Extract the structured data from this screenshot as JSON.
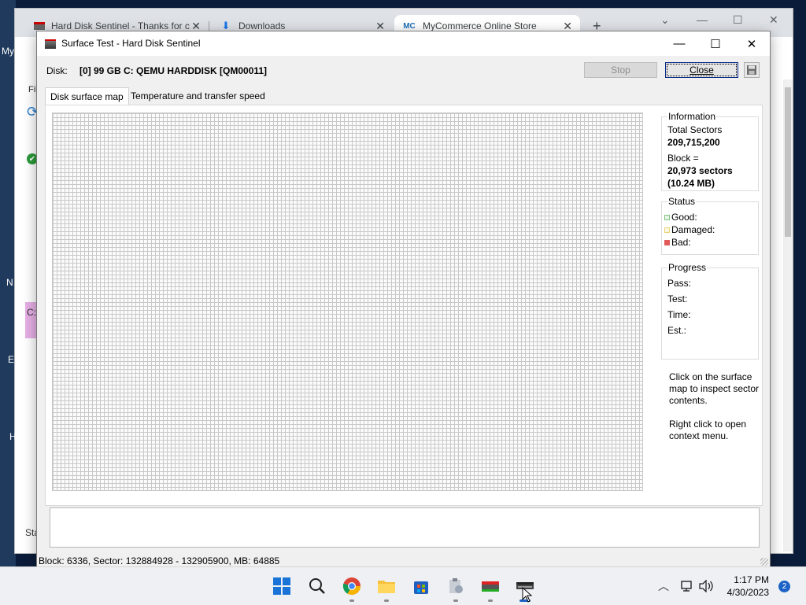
{
  "browser": {
    "tabs": [
      {
        "label": "Hard Disk Sentinel - Thanks for c",
        "close": "✕"
      },
      {
        "label": "Downloads",
        "close": "✕"
      },
      {
        "label": "MyCommerce Online Store",
        "close": "✕"
      }
    ],
    "new_tab": "+",
    "left_edge_text": [
      "My",
      "Fil",
      "N",
      "C:",
      "E",
      "H",
      "Sta"
    ]
  },
  "dialog": {
    "title": "Surface Test - Hard Disk Sentinel",
    "disk_label": "Disk:",
    "disk_value": "[0] 99 GB C: QEMU HARDDISK [QM00011]",
    "stop_label": "Stop",
    "close_label": "Close",
    "tabs": [
      "Disk surface map",
      "Temperature and transfer speed"
    ],
    "information": {
      "title": "Information",
      "total_sectors_label": "Total Sectors",
      "total_sectors": "209,715,200",
      "block_label": "Block =",
      "block_sectors": "20,973 sectors",
      "block_size": "(10.24 MB)"
    },
    "status": {
      "title": "Status",
      "good": "Good:",
      "damaged": "Damaged:",
      "bad": "Bad:",
      "colors": {
        "good": "#7fc47f",
        "damaged": "#e8d27a",
        "bad": "#e05a5a"
      }
    },
    "progress": {
      "title": "Progress",
      "pass": "Pass:",
      "test": "Test:",
      "time": "Time:",
      "est": "Est.:"
    },
    "hint1": "Click on the surface map to inspect sector contents.",
    "hint2": "Right click to open context menu.",
    "statusbar": "Block: 6336, Sector: 132884928 - 132905900, MB: 64885"
  },
  "taskbar": {
    "time": "1:17 PM",
    "date": "4/30/2023",
    "notifications": "2"
  }
}
